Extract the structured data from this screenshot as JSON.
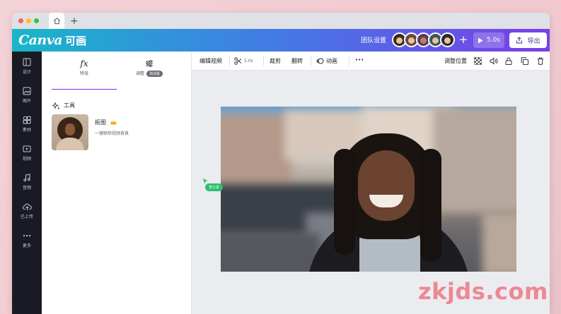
{
  "browser": {
    "dot_colors": [
      "#fe5f57",
      "#febc2e",
      "#28c840"
    ],
    "new_tab": "+"
  },
  "header": {
    "logo": "Canva",
    "logo_extra": "可画",
    "team_label": "团队设置",
    "add_member": "+",
    "avatar_colors": [
      "#3a2a20",
      "#6a4a3a",
      "#5a3a5a",
      "#3a5a5a",
      "#2a2a2a"
    ],
    "play_label": "5.0s",
    "export_label": "导出",
    "gradient_colors": [
      "#19b6c8",
      "#3f7fe4",
      "#7a3ee8"
    ]
  },
  "rail": {
    "items": [
      {
        "label": "设计",
        "icon": "layout-icon"
      },
      {
        "label": "图片",
        "icon": "image-icon"
      },
      {
        "label": "素材",
        "icon": "elements-icon"
      },
      {
        "label": "视频",
        "icon": "video-icon"
      },
      {
        "label": "音频",
        "icon": "music-icon"
      },
      {
        "label": "已上传",
        "icon": "upload-icon"
      },
      {
        "label": "更多",
        "icon": "more-icon"
      }
    ]
  },
  "panel": {
    "tab_effects_icon": "fx",
    "tab_effects": "特效",
    "tab_adjust": "调整",
    "tab_adjust_badge": "测试版",
    "tools_title": "工具",
    "tool_name": "抠图",
    "tool_desc": "一键移除视频背景"
  },
  "toolbar": {
    "edit_video": "编辑视频",
    "trim": "5.0s",
    "crop": "裁剪",
    "flip": "翻转",
    "animate": "动画",
    "more": "•••",
    "position": "调整位置"
  },
  "canvas": {
    "collaborator": "李小青",
    "collaborator_color": "#2cbf6e"
  },
  "watermark": "zkjds.com"
}
